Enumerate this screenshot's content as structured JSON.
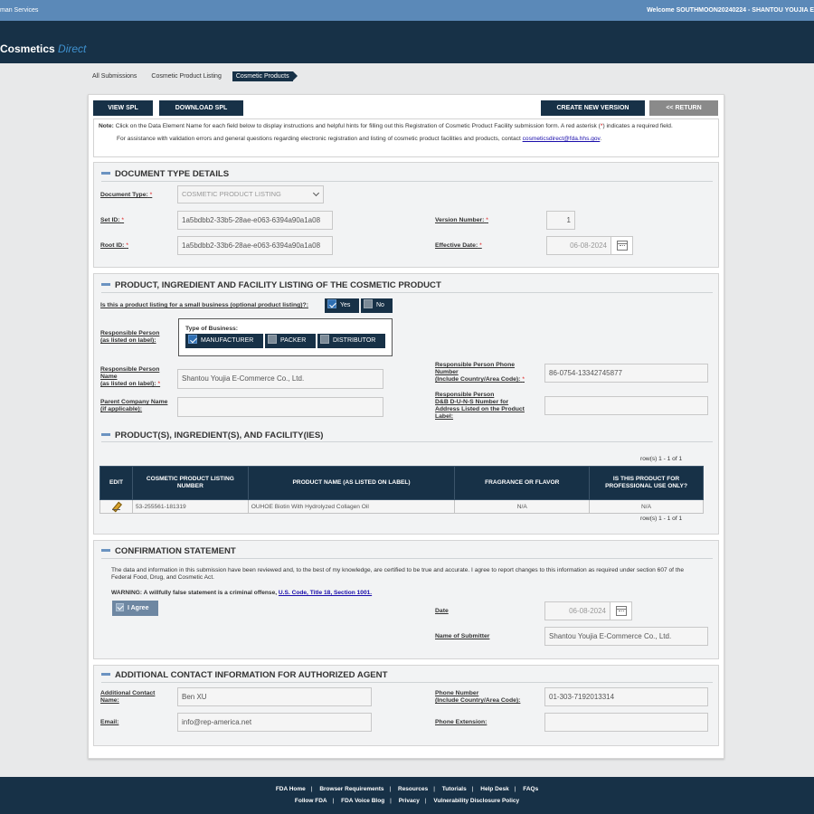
{
  "topbar": {
    "left": "man Services",
    "welcome": "Welcome SOUTHMOON20240224 - SHANTOU YOUJIA E"
  },
  "logo": {
    "name": "Cosmetics",
    "suffix": "Direct"
  },
  "breadcrumbs": [
    "All Submissions",
    "Cosmetic Product Listing",
    "Cosmetic Products"
  ],
  "toolbar": {
    "view_spl": "VIEW SPL",
    "download_spl": "DOWNLOAD SPL",
    "create_new_version": "CREATE NEW VERSION",
    "return": "<< RETURN"
  },
  "note": {
    "prefix": "Note:",
    "text1": " Click on the Data Element Name for each field below to display instructions and helpful hints for filling out this Registration of Cosmetic Product Facility submission form. A red asterisk (",
    "asterisk": "*",
    "text2": ") indicates a required field.",
    "assist": "For assistance with validation errors and general questions regarding electronic registration and listing of cosmetic product facilities and products, contact ",
    "email": "cosmeticsdirect@fda.hhs.gov",
    "period": "."
  },
  "doc_type": {
    "title": "DOCUMENT TYPE DETAILS",
    "document_type_label": "Document Type:",
    "document_type_value": "COSMETIC PRODUCT LISTING",
    "set_id_label": "Set ID:",
    "set_id_value": "1a5bdbb2-33b5-28ae-e063-6394a90a1a08",
    "root_id_label": "Root ID:",
    "root_id_value": "1a5bdbb2-33b6-28ae-e063-6394a90a1a08",
    "version_label": "Version Number:",
    "version_value": "1",
    "effective_date_label": "Effective Date:",
    "effective_date_value": "06-08-2024",
    "required_mark": "*"
  },
  "listing": {
    "title": "PRODUCT, INGREDIENT AND FACILITY LISTING OF THE COSMETIC PRODUCT",
    "small_business_label": "Is this a product listing for a small business (optional product listing)?:",
    "yes": "Yes",
    "no": "No",
    "responsible_person_label_1": "Responsible Person",
    "responsible_person_label_2": "(as listed on label):",
    "type_of_business_label": "Type of Business:",
    "business_types": [
      "MANUFACTURER",
      "PACKER",
      "DISTRIBUTOR"
    ],
    "rp_name_label_1": "Responsible Person",
    "rp_name_label_2": "Name",
    "rp_name_label_3": "(as listed on label):",
    "rp_name_value": "Shantou Youjia E-Commerce Co., Ltd.",
    "parent_company_label_1": "Parent Company Name",
    "parent_company_label_2": "(if applicable):",
    "parent_company_value": "",
    "phone_label_1": "Responsible Person Phone",
    "phone_label_2": "Number",
    "phone_label_3": "(Include Country/Area Code):",
    "phone_value": "86-0754-13342745877",
    "duns_label_1": "Responsible Person",
    "duns_label_2": "D&B D-U-N-S Number for",
    "duns_label_3": "Address Listed on the Product",
    "duns_label_4": "Label:",
    "duns_value": "",
    "required_mark": "*"
  },
  "products": {
    "title": "PRODUCT(S), INGREDIENT(S), AND FACILITY(IES)",
    "row_info": "row(s) 1 - 1 of 1",
    "columns": [
      "EDIT",
      "COSMETIC PRODUCT LISTING NUMBER",
      "PRODUCT NAME (AS LISTED ON LABEL)",
      "FRAGRANCE OR FLAVOR",
      "IS THIS PRODUCT FOR PROFESSIONAL USE ONLY?"
    ],
    "rows": [
      {
        "listing_number": "53-255561-181319",
        "product_name": "OUHOE Biotin With Hydrolyzed Collagen Oil",
        "fragrance": "N/A",
        "professional": "N/A"
      }
    ]
  },
  "confirmation": {
    "title": "CONFIRMATION STATEMENT",
    "statement": "The data and information in this submission have been reviewed and, to the best of my knowledge, are certified to be true and accurate. I agree to report changes to this information as required under section 607 of the Federal Food, Drug, and Cosmetic Act.",
    "warning": "WARNING: A willfully false statement is a criminal offense, ",
    "warning_link": "U.S. Code, Title 18, Section 1001.",
    "agree": "I Agree",
    "date_label": "Date",
    "date_value": "06-08-2024",
    "submitter_label": "Name of Submitter",
    "submitter_value": "Shantou Youjia E-Commerce Co., Ltd."
  },
  "agent": {
    "title": "ADDITIONAL CONTACT INFORMATION FOR AUTHORIZED AGENT",
    "contact_label_1": "Additional Contact",
    "contact_label_2": "Name:",
    "contact_value": "Ben XU",
    "email_label": "Email:",
    "email_value": "info@rep-america.net",
    "phone_label_1": "Phone Number",
    "phone_label_2": "(Include Country/Area Code):",
    "phone_value": "01-303-7192013314",
    "ext_label": "Phone Extension:",
    "ext_value": ""
  },
  "footer": {
    "row1": [
      "FDA Home",
      "Browser Requirements",
      "Resources",
      "Tutorials",
      "Help Desk",
      "FAQs"
    ],
    "row2": [
      "Follow FDA",
      "FDA Voice Blog",
      "Privacy",
      "Vulnerability Disclosure Policy"
    ],
    "separator": "|"
  },
  "colors": {
    "navy": "#173147",
    "topbar": "#5b89b8",
    "accent": "#3f92d0",
    "required": "#d11111"
  }
}
